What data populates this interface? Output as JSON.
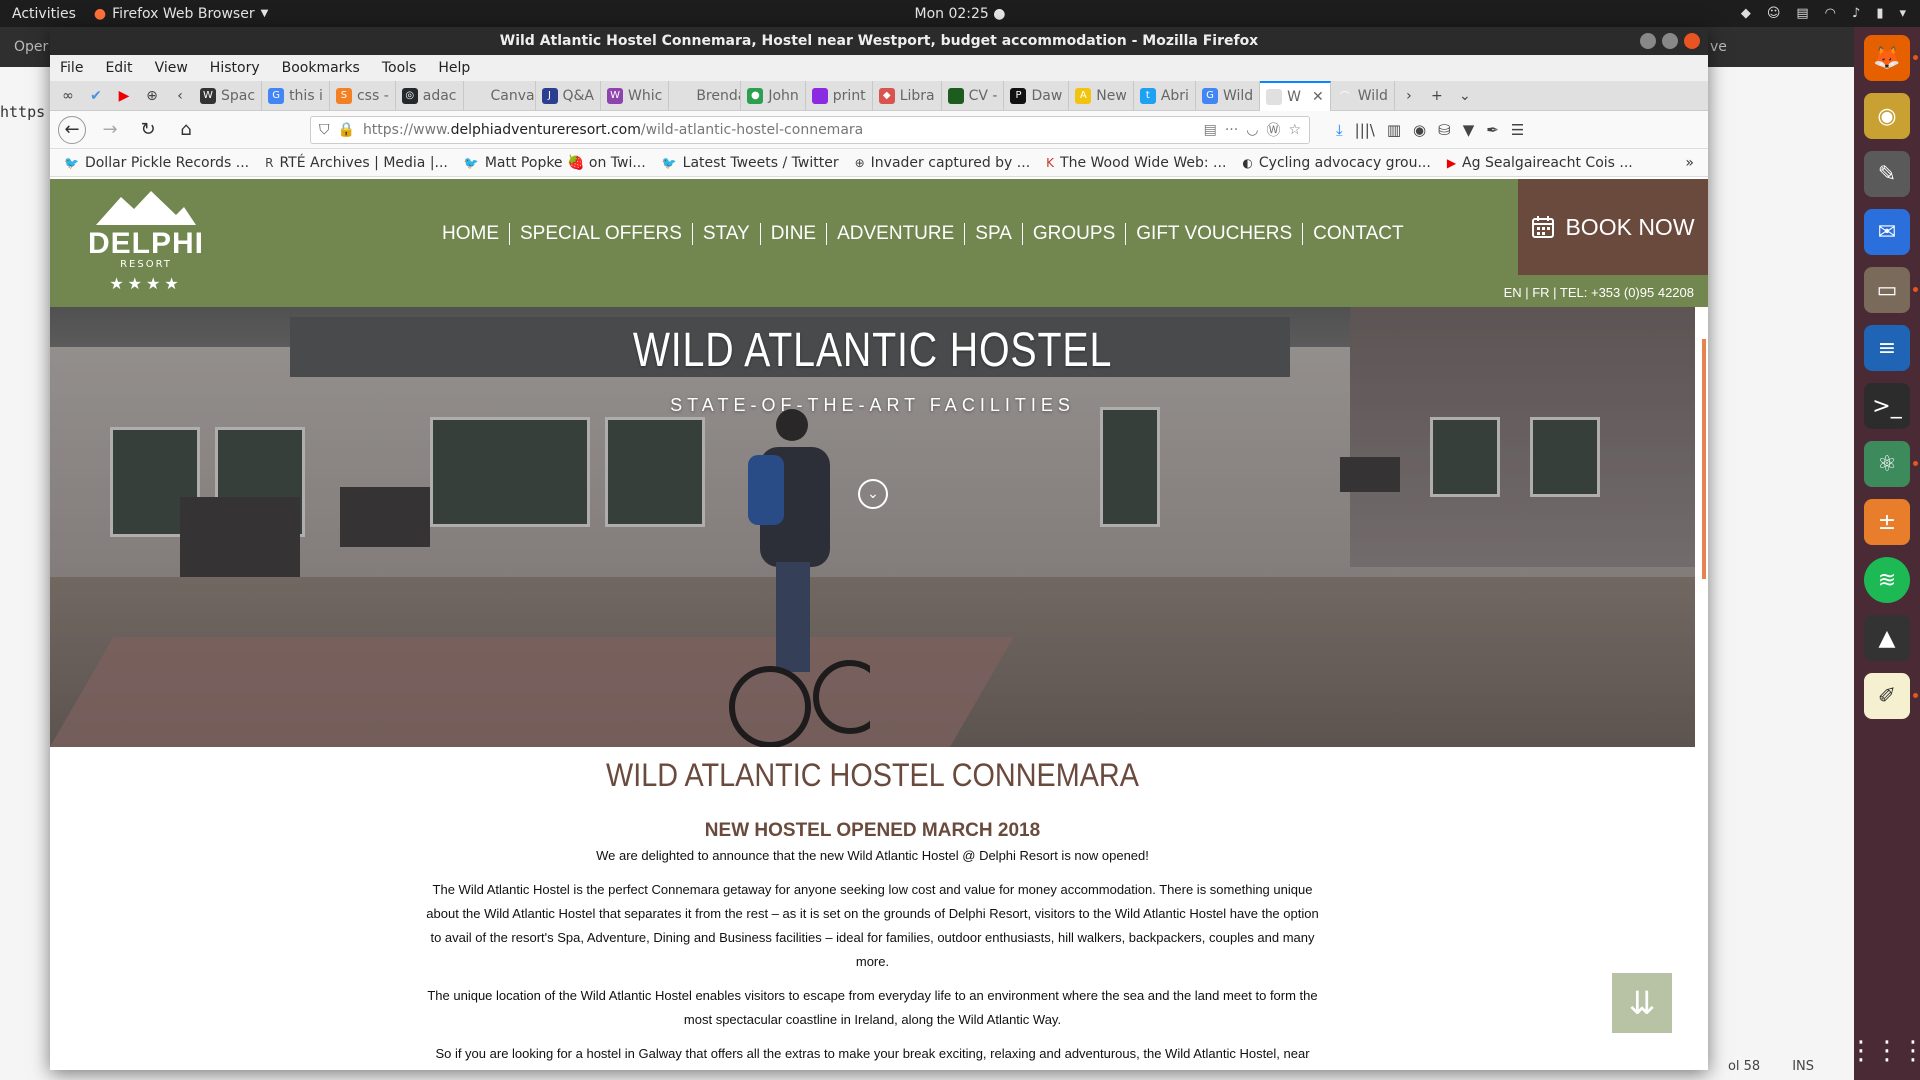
{
  "desktop": {
    "activities": "Activities",
    "app_menu": "Firefox Web Browser",
    "clock": "Mon 02:25 ●",
    "dock_items": [
      "firefox-icon",
      "rhythmbox-icon",
      "gimp-icon",
      "thunderbird-icon",
      "files-icon",
      "writer-icon",
      "terminal-icon",
      "atom-icon",
      "calculator-icon",
      "spotify-icon",
      "inkscape-icon",
      "text-editor-icon"
    ]
  },
  "bg_window": {
    "title_fragment": "Oper",
    "text_fragment": "https",
    "right_fragment": "ve",
    "status_col": "ol 58",
    "status_ins": "INS"
  },
  "firefox": {
    "title": "Wild Atlantic Hostel Connemara, Hostel near Westport, budget accommodation - Mozilla Firefox",
    "menu": [
      "File",
      "Edit",
      "View",
      "History",
      "Bookmarks",
      "Tools",
      "Help"
    ],
    "tabs": [
      {
        "label": "Spac",
        "color": "#333",
        "glyph": "W"
      },
      {
        "label": "this i",
        "color": "#4285f4",
        "glyph": "G"
      },
      {
        "label": "css -",
        "color": "#f48024",
        "glyph": "S"
      },
      {
        "label": "adac",
        "color": "#24292e",
        "glyph": "◎"
      },
      {
        "label": "Canvas !",
        "color": "#e0e0e0",
        "glyph": ""
      },
      {
        "label": "Q&A",
        "color": "#2c3e8f",
        "glyph": "J"
      },
      {
        "label": "Whic",
        "color": "#8e44ad",
        "glyph": "W"
      },
      {
        "label": "Brendan",
        "color": "#e0e0e0",
        "glyph": ""
      },
      {
        "label": "John",
        "color": "#2e9e4f",
        "glyph": "●"
      },
      {
        "label": "print",
        "color": "#8a2be2",
        "glyph": ""
      },
      {
        "label": "Libra",
        "color": "#d9534f",
        "glyph": "◆"
      },
      {
        "label": "CV -",
        "color": "#1e5b1e",
        "glyph": ""
      },
      {
        "label": "Daw",
        "color": "#111",
        "glyph": "P"
      },
      {
        "label": "New",
        "color": "#f1c40f",
        "glyph": "A"
      },
      {
        "label": "Abri",
        "color": "#1da1f2",
        "glyph": "t"
      },
      {
        "label": "Wild",
        "color": "#4285f4",
        "glyph": "G"
      },
      {
        "label": "W",
        "color": "#e0e0e0",
        "glyph": "",
        "active": true
      },
      {
        "label": "Wild",
        "color": "#e0e0e0",
        "glyph": "⌒"
      }
    ],
    "url_prefix": "https://www.",
    "url_domain": "delphiadventureresort.com",
    "url_path": "/wild-atlantic-hostel-connemara",
    "bookmarks": [
      {
        "label": "Dollar Pickle Records ...",
        "icon": "twitter-icon"
      },
      {
        "label": "RTÉ Archives | Media |...",
        "icon": "rte-icon"
      },
      {
        "label": "Matt Popke 🍓 on Twi...",
        "icon": "twitter-icon"
      },
      {
        "label": "Latest Tweets / Twitter",
        "icon": "twitter-icon"
      },
      {
        "label": "Invader captured by ...",
        "icon": "globe-icon"
      },
      {
        "label": "The Wood Wide Web: ...",
        "icon": "k-icon"
      },
      {
        "label": "Cycling advocacy grou...",
        "icon": "c-icon"
      },
      {
        "label": "Ag Sealgaireacht Cois ...",
        "icon": "youtube-icon"
      }
    ]
  },
  "site": {
    "logo_name": "DELPHI",
    "logo_sub": "RESORT",
    "logo_stars": "★★★★",
    "nav": [
      "HOME",
      "SPECIAL OFFERS",
      "STAY",
      "DINE",
      "ADVENTURE",
      "SPA",
      "GROUPS",
      "GIFT VOUCHERS",
      "CONTACT"
    ],
    "book_now": "BOOK NOW",
    "contact_line": "EN | FR | TEL: +353 (0)95 42208",
    "hero_title": "WILD ATLANTIC HOSTEL",
    "hero_subtitle": "STATE-OF-THE-ART FACILITIES",
    "h1": "WILD ATLANTIC HOSTEL CONNEMARA",
    "h2": "NEW HOSTEL OPENED MARCH 2018",
    "p1": "We are delighted to announce that the new Wild Atlantic Hostel @ Delphi Resort is now opened!",
    "p2": "The Wild Atlantic Hostel is the perfect Connemara getaway for anyone seeking low cost and value for money accommodation. There is something unique about the Wild Atlantic Hostel that separates it from the rest – as it is set on the grounds of Delphi Resort, visitors to the Wild Atlantic Hostel have the option to avail of the resort's Spa, Adventure, Dining and Business facilities – ideal for families, outdoor enthusiasts, hill walkers, backpackers, couples and many more.",
    "p3": "The unique location of the Wild Atlantic Hostel enables visitors to escape from everyday life to an environment where the sea and the land meet to form the most spectacular coastline in Ireland, along the Wild Atlantic Way.",
    "p4": "So if you are looking for a hostel in Galway that offers all the extras to make your break exciting, relaxing and adventurous, the Wild Atlantic Hostel, near Westport,  is the place for you.",
    "colors": {
      "header_green": "#72874f",
      "brown": "#6a4a3c",
      "backtop": "#b7c3a4"
    }
  }
}
